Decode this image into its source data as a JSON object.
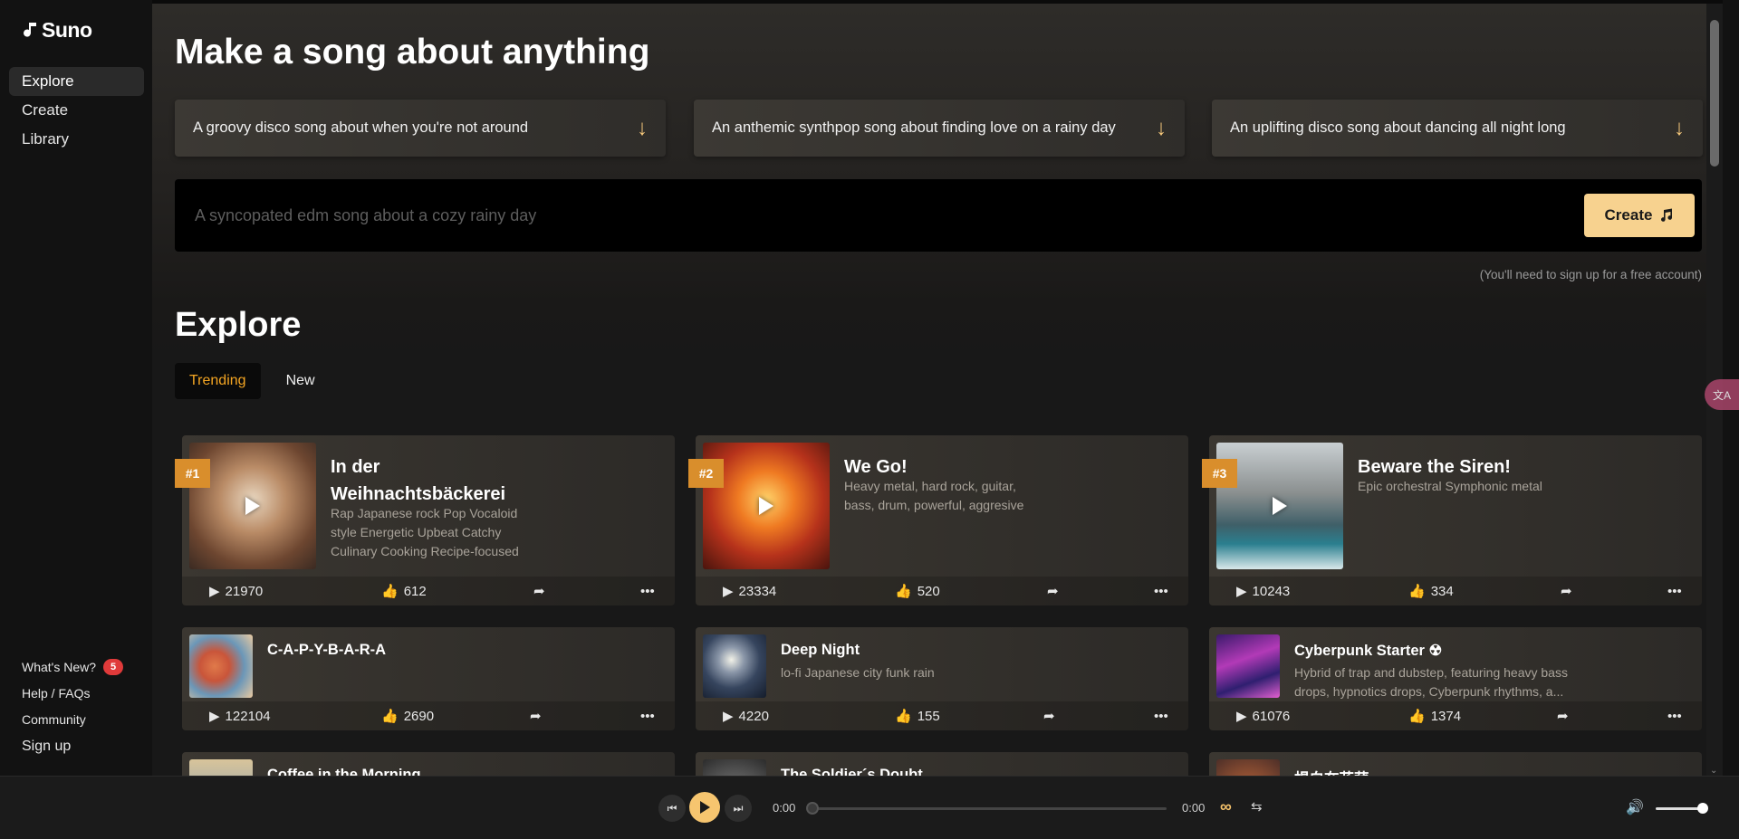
{
  "app": {
    "name": "Suno"
  },
  "sidebar": {
    "items": [
      {
        "label": "Explore",
        "active": true
      },
      {
        "label": "Create",
        "active": false
      },
      {
        "label": "Library",
        "active": false
      }
    ],
    "bottom": {
      "whats_new": "What's New?",
      "whats_new_count": "5",
      "help": "Help / FAQs",
      "community": "Community",
      "signup": "Sign up"
    }
  },
  "hero": {
    "title": "Make a song about anything",
    "suggestions": [
      "A groovy disco song about when you're not around",
      "An anthemic synthpop song about finding love on a rainy day",
      "An uplifting disco song about dancing all night long"
    ],
    "prompt_placeholder": "A syncopated edm song about a cozy rainy day",
    "create_label": "Create",
    "note": "(You'll need to sign up for a free account)"
  },
  "explore": {
    "title": "Explore",
    "tabs": [
      {
        "label": "Trending",
        "active": true
      },
      {
        "label": "New",
        "active": false
      }
    ],
    "featured": [
      {
        "rank": "#1",
        "title_line1": "In der",
        "title_line2": "Weihnachtsbäckerei",
        "desc_line1": "Rap Japanese rock Pop Vocaloid",
        "desc_line2": "style Energetic Upbeat Catchy",
        "desc_line3": "Culinary Cooking Recipe-focused",
        "plays": "21970",
        "likes": "612"
      },
      {
        "rank": "#2",
        "title_line1": "We Go!",
        "title_line2": "",
        "desc_line1": "Heavy metal, hard rock, guitar,",
        "desc_line2": "bass, drum, powerful, aggresive",
        "desc_line3": "",
        "plays": "23334",
        "likes": "520"
      },
      {
        "rank": "#3",
        "title_line1": "Beware the Siren!",
        "title_line2": "",
        "desc_line1": "Epic orchestral Symphonic metal",
        "desc_line2": "",
        "desc_line3": "",
        "plays": "10243",
        "likes": "334"
      }
    ],
    "row2": [
      {
        "title": "C-A-P-Y-B-A-R-A",
        "desc_line1": "",
        "desc_line2": "",
        "plays": "122104",
        "likes": "2690"
      },
      {
        "title": "Deep Night",
        "desc_line1": "lo-fi Japanese city funk rain",
        "desc_line2": "",
        "plays": "4220",
        "likes": "155"
      },
      {
        "title": "Cyberpunk Starter ☢",
        "desc_line1": "Hybrid of trap and dubstep, featuring heavy bass",
        "desc_line2": "drops, hypnotics drops, Cyberpunk rhythms, a...",
        "plays": "61076",
        "likes": "1374"
      }
    ],
    "row3": [
      {
        "title": "Coffee in the Morning"
      },
      {
        "title": "The Soldier´s Doubt"
      },
      {
        "title": "楊白在花莚"
      }
    ]
  },
  "player": {
    "current_time": "0:00",
    "duration": "0:00",
    "progress": 0,
    "volume": 0.8
  },
  "translate_label": "文A",
  "colors": {
    "accent": "#f7d28f",
    "rank": "#d98e2c",
    "trending": "#f5a623"
  }
}
